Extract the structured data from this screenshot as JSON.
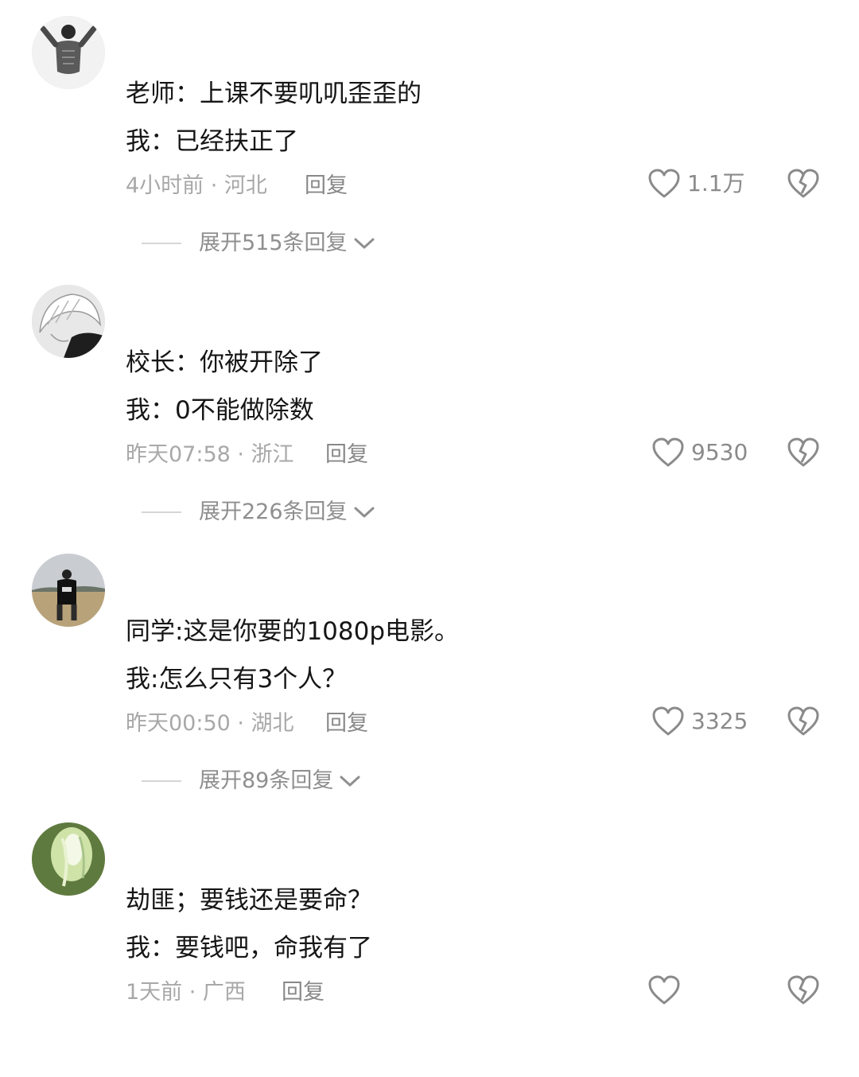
{
  "comments": [
    {
      "line1": "老师：上课不要叽叽歪歪的",
      "line2": "我：已经扶正了",
      "meta": "4小时前 · 河北",
      "reply": "回复",
      "likes": "1.1万",
      "expand": "展开515条回复",
      "avatar_icon": "shirtless-man-avatar"
    },
    {
      "line1": "校长：你被开除了",
      "line2": "我：0不能做除数",
      "meta": "昨天07:58 · 浙江",
      "reply": "回复",
      "likes": "9530",
      "expand": "展开226条回复",
      "avatar_icon": "anime-character-avatar"
    },
    {
      "line1": "同学:这是你要的1080p电影。",
      "line2": "我:怎么只有3个人？",
      "meta": "昨天00:50 · 湖北",
      "reply": "回复",
      "likes": "3325",
      "expand": "展开89条回复",
      "avatar_icon": "person-in-field-avatar"
    },
    {
      "line1": "劫匪；要钱还是要命？",
      "line2": "我：要钱吧，命我有了",
      "meta": "1天前 · 广西",
      "reply": "回复",
      "likes": "",
      "expand": "",
      "avatar_icon": "glowing-figure-avatar"
    }
  ],
  "colors": {
    "text": "#161616",
    "meta": "#a8a8a8",
    "icon": "#8a8a8a"
  }
}
